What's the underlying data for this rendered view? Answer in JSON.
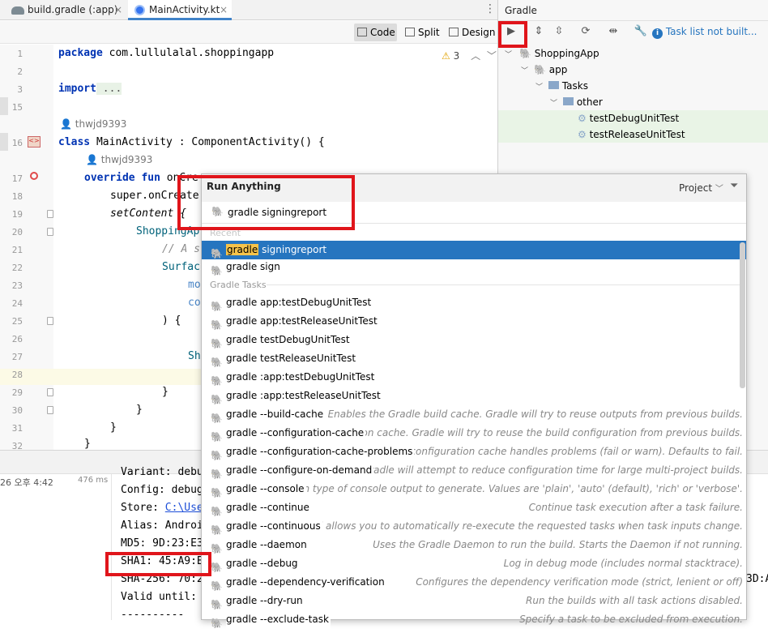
{
  "tabs": [
    {
      "label": "build.gradle (:app)",
      "close": "×"
    },
    {
      "label": "MainActivity.kt",
      "close": "×"
    }
  ],
  "editor_toolbar": {
    "code": "Code",
    "split": "Split",
    "design": "Design",
    "warnings": "3"
  },
  "editor": {
    "line_numbers": [
      "1",
      "2",
      "3",
      "15",
      "16",
      "17",
      "18",
      "19",
      "20",
      "21",
      "22",
      "23",
      "24",
      "25",
      "26",
      "27",
      "28",
      "29",
      "30",
      "31",
      "32"
    ],
    "line1": {
      "kw": "package",
      "rest": " com.lullulalal.shoppingapp"
    },
    "line3": {
      "kw": "import",
      "rest": " ..."
    },
    "author1": "thwjd9393",
    "line16": {
      "kw": "class",
      "rest": " MainActivity : ComponentActivity() {"
    },
    "author2": "thwjd9393",
    "line17": {
      "kw": "override fun",
      "rest": " onCre"
    },
    "line18": "super.onCreate",
    "line19": "setContent {",
    "line20": "ShoppingAp",
    "line21": "// A s",
    "line22": "Surfac",
    "line23": "mo",
    "line24": "co",
    "line25": ") {",
    "line27": "Sh",
    "line29": "}",
    "line30": "}",
    "line31": "}",
    "line32": "}"
  },
  "gradle_panel": {
    "title": "Gradle",
    "status": "Task list not built...",
    "tree": [
      "ShoppingApp",
      "app",
      "Tasks",
      "other",
      "testDebugUnitTest",
      "testReleaseUnitTest"
    ]
  },
  "run_anything": {
    "title": "Run Anything",
    "scope": "Project",
    "query": "gradle signingreport",
    "section_recent": "Recent",
    "section_tasks": "Gradle Tasks",
    "recent": [
      {
        "prefix": "gradle",
        "rest": " signingreport"
      },
      {
        "prefix": "",
        "rest": "gradle sign"
      }
    ],
    "items": [
      {
        "label": "gradle app:testDebugUnitTest",
        "desc": ""
      },
      {
        "label": "gradle app:testReleaseUnitTest",
        "desc": ""
      },
      {
        "label": "gradle testDebugUnitTest",
        "desc": ""
      },
      {
        "label": "gradle testReleaseUnitTest",
        "desc": ""
      },
      {
        "label": "gradle :app:testDebugUnitTest",
        "desc": ""
      },
      {
        "label": "gradle :app:testReleaseUnitTest",
        "desc": ""
      },
      {
        "label": "gradle --build-cache",
        "desc": "Enables the Gradle build cache. Gradle will try to reuse outputs from previous builds."
      },
      {
        "label": "gradle --configuration-cache",
        "desc": "configuration cache. Gradle will try to reuse the build configuration from previous builds."
      },
      {
        "label": "gradle --configuration-cache-problems",
        "desc": "es how the configuration cache handles problems (fail or warn). Defaults to fail."
      },
      {
        "label": "gradle --configure-on-demand",
        "desc": "cts only. Gradle will attempt to reduce configuration time for large multi-project builds."
      },
      {
        "label": "gradle --console",
        "desc": "pecifies which type of console output to generate. Values are 'plain', 'auto' (default), 'rich' or 'verbose'."
      },
      {
        "label": "gradle --continue",
        "desc": "Continue task execution after a task failure."
      },
      {
        "label": "gradle --continuous",
        "desc": "ntinuous Build allows you to automatically re-execute the requested tasks when task inputs change."
      },
      {
        "label": "gradle --daemon",
        "desc": "Uses the Gradle Daemon to run the build. Starts the Daemon if not running."
      },
      {
        "label": "gradle --debug",
        "desc": "Log in debug mode (includes normal stacktrace)."
      },
      {
        "label": "gradle --dependency-verification",
        "desc": "Configures the dependency verification mode (strict, lenient or off)"
      },
      {
        "label": "gradle --dry-run",
        "desc": "Run the builds with all task actions disabled."
      },
      {
        "label": "gradle --exclude-task",
        "desc": "Specify a task to be excluded from execution."
      }
    ]
  },
  "run_panel": {
    "timestamp": "26 오후 4:42",
    "duration": "476 ms",
    "console": [
      "Variant: debu",
      "Config: debug",
      "Store: ",
      "Alias: Androi",
      "MD5: 9D:23:E3",
      "SHA1: 45:A9:E",
      "SHA-256: 70:2",
      "Valid until: ",
      "----------"
    ],
    "store_link": "C:\\Use",
    "right_fragment": "3D:A"
  },
  "colors": {
    "accent": "#2675bf",
    "highlight_red": "#e0151b",
    "selection": "#2675bf",
    "match": "#f7c44a"
  }
}
